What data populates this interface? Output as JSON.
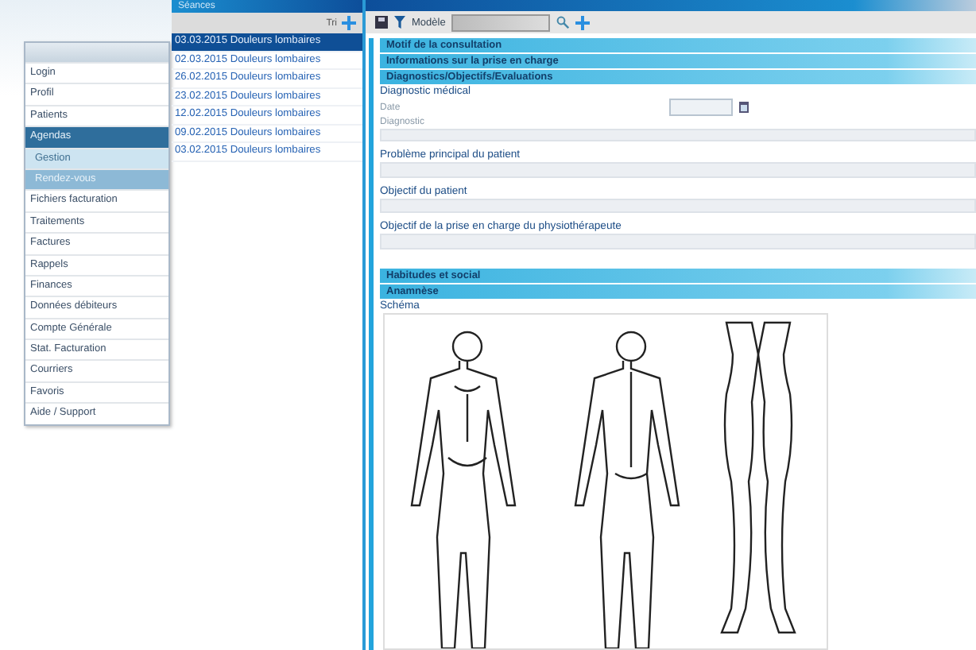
{
  "sessions_panel": {
    "title": "Séances",
    "sort_button": "Tri",
    "items": [
      {
        "label": "03.03.2015 Douleurs lombaires",
        "selected": true
      },
      {
        "label": "02.03.2015 Douleurs lombaires",
        "selected": false
      },
      {
        "label": "26.02.2015 Douleurs lombaires",
        "selected": false
      },
      {
        "label": "23.02.2015 Douleurs lombaires",
        "selected": false
      },
      {
        "label": "12.02.2015 Douleurs lombaires",
        "selected": false
      },
      {
        "label": "09.02.2015 Douleurs lombaires",
        "selected": false
      },
      {
        "label": "03.02.2015 Douleurs lombaires",
        "selected": false
      }
    ]
  },
  "menu": {
    "items": [
      {
        "label": "Login",
        "selected": false
      },
      {
        "label": "Profil",
        "selected": false
      },
      {
        "label": "Patients",
        "selected": false
      },
      {
        "label": "Agendas",
        "selected": true,
        "children": [
          {
            "label": "Gestion",
            "selected": true
          },
          {
            "label": "Rendez-vous",
            "selected": false
          }
        ]
      },
      {
        "label": "Fichiers facturation",
        "selected": false
      },
      {
        "label": "Traitements",
        "selected": false
      },
      {
        "label": "Factures",
        "selected": false
      },
      {
        "label": "Rappels",
        "selected": false
      },
      {
        "label": "Finances",
        "selected": false
      },
      {
        "label": "Données débiteurs",
        "selected": false
      },
      {
        "label": "Compte Générale",
        "selected": false
      },
      {
        "label": "Stat. Facturation",
        "selected": false
      },
      {
        "label": "Courriers",
        "selected": false
      },
      {
        "label": "Favoris",
        "selected": false
      },
      {
        "label": "Aide / Support",
        "selected": false
      }
    ]
  },
  "toolbar": {
    "model_label": "Modèle"
  },
  "form": [
    {
      "kind": "section",
      "label": "Motif de la consultation"
    },
    {
      "kind": "section",
      "label": "Informations sur la prise en charge"
    },
    {
      "kind": "section",
      "label": "Diagnostics/Objectifs/Evaluations"
    },
    {
      "kind": "heading",
      "label": "Diagnostic médical"
    },
    {
      "kind": "date",
      "label": "Date"
    },
    {
      "kind": "small_textarea",
      "label": "Diagnostic"
    },
    {
      "kind": "textarea",
      "label": "Problème principal du patient"
    },
    {
      "kind": "textarea",
      "label": "Objectif du patient"
    },
    {
      "kind": "textarea",
      "label": "Objectif de la prise en charge du physiothérapeute"
    },
    {
      "kind": "spacer"
    },
    {
      "kind": "section",
      "label": "Habitudes et social"
    },
    {
      "kind": "section",
      "label": "Anamnèse"
    },
    {
      "kind": "heading",
      "label": "Schéma"
    },
    {
      "kind": "body_chart"
    }
  ]
}
